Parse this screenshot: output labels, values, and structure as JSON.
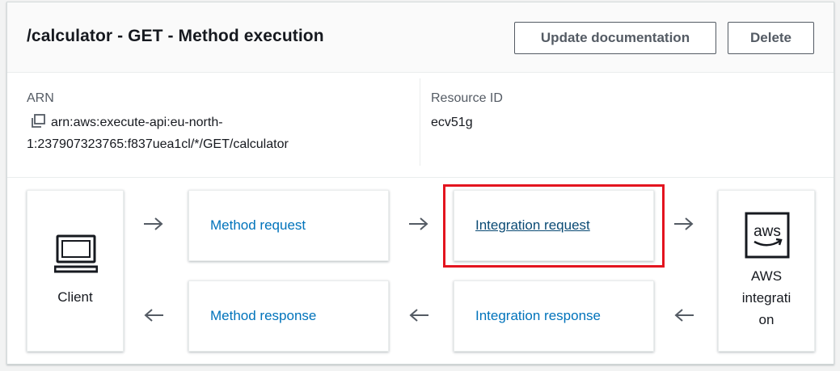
{
  "header": {
    "title": "/calculator - GET - Method execution",
    "update_button": "Update documentation",
    "delete_button": "Delete"
  },
  "details": {
    "arn_label": "ARN",
    "arn_value_line1": "arn:aws:execute-api:eu-north-",
    "arn_value_line2": "1:237907323765:f837uea1cl/*/GET/calculator",
    "resource_id_label": "Resource ID",
    "resource_id_value": "ecv51g"
  },
  "flow": {
    "client_label": "Client",
    "method_request": "Method request",
    "integration_request": "Integration request",
    "method_response": "Method response",
    "integration_response": "Integration response",
    "aws_label_lines": [
      "AWS",
      "integrati",
      "on"
    ],
    "aws_logo_text": "aws"
  },
  "colors": {
    "link": "#0073bb",
    "highlight": "#e3141f",
    "button_border": "#545b64"
  }
}
